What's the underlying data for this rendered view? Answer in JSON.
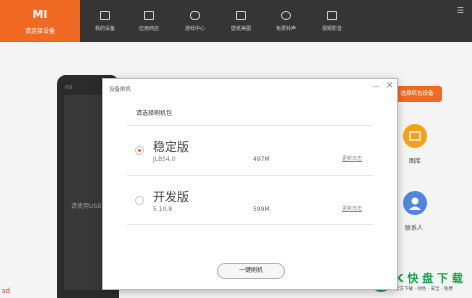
{
  "app": {
    "brand_logo": "MI",
    "brand_sub": "请连接设备"
  },
  "nav": [
    {
      "label": "我的设备",
      "icon": "device-icon"
    },
    {
      "label": "应用商店",
      "icon": "store-icon"
    },
    {
      "label": "游戏中心",
      "icon": "gamepad-icon"
    },
    {
      "label": "壁纸美图",
      "icon": "wallpaper-icon"
    },
    {
      "label": "免费铃声",
      "icon": "music-icon"
    },
    {
      "label": "视频影音",
      "icon": "video-icon"
    }
  ],
  "background": {
    "phone_label": "mi",
    "phone_text": "请使用USB",
    "orange_button": "选择机包设备",
    "side_items": [
      {
        "label": "图库",
        "color": "#f3a21b"
      },
      {
        "label": "联系人",
        "color": "#4f86d9"
      }
    ],
    "sd_text": "sd"
  },
  "watermark": {
    "title": "K 快 盘 下 载",
    "sub": "官方下载 · 绿色 · 安全 · 免费"
  },
  "dialog": {
    "title": "设备刷机",
    "prompt": "请选择刷机包",
    "options": [
      {
        "name": "稳定版",
        "version": "JLB54.0",
        "size": "497M",
        "log": "更新日志",
        "selected": true
      },
      {
        "name": "开发版",
        "version": "5.10.8",
        "size": "599M",
        "log": "更新日志",
        "selected": false
      }
    ],
    "flash_button": "一键刷机"
  },
  "colors": {
    "accent": "#f06a24",
    "topbar": "#353535",
    "watermark_green": "#1aa14a"
  }
}
